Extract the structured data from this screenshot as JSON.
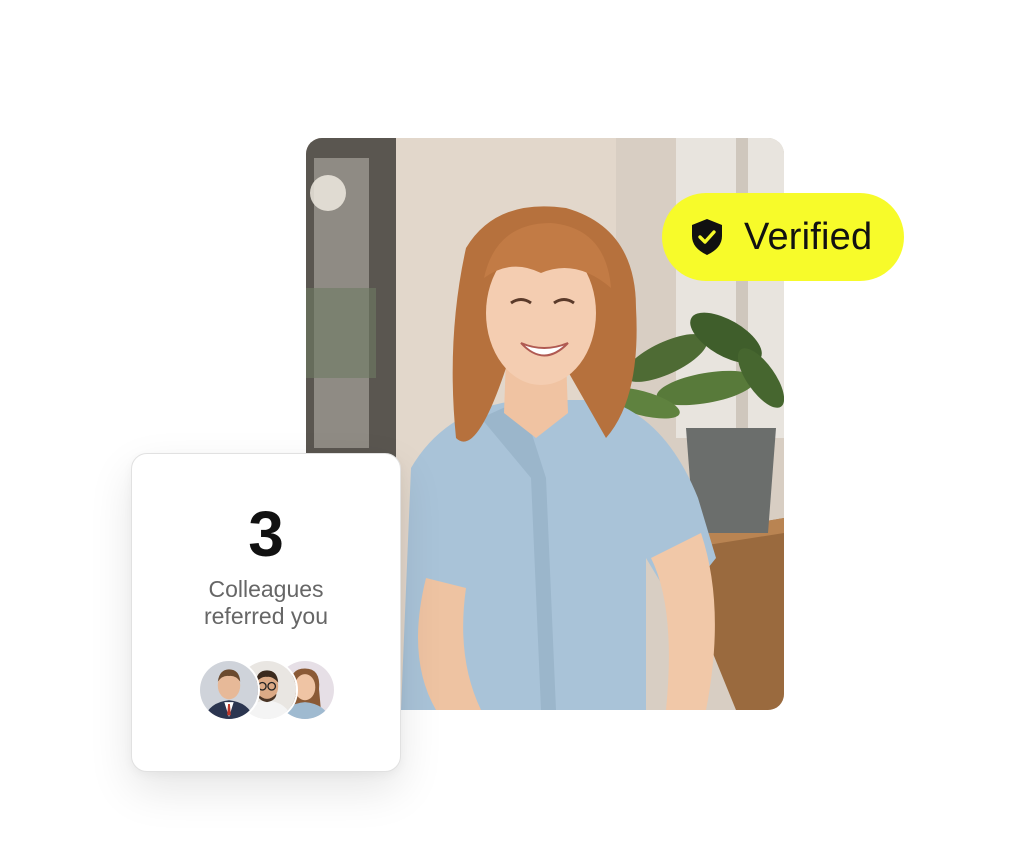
{
  "verified_badge": {
    "label": "Verified",
    "icon": "shield-check-icon",
    "background": "#f7fb2a"
  },
  "referral_card": {
    "count": "3",
    "line1": "Colleagues",
    "line2": "referred you",
    "avatars": [
      {
        "icon": "avatar-man-suit"
      },
      {
        "icon": "avatar-man-glasses"
      },
      {
        "icon": "avatar-woman"
      }
    ]
  },
  "photo": {
    "icon": "profile-photo-smiling-woman"
  }
}
